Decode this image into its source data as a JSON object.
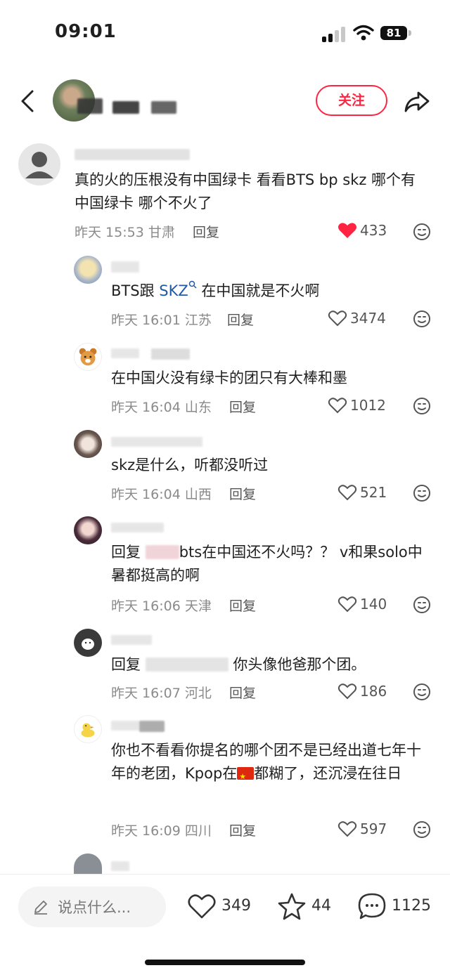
{
  "status": {
    "time": "09:01",
    "battery": "81"
  },
  "header": {
    "follow_label": "关注"
  },
  "comments": [
    {
      "text": "真的火的压根没有中国绿卡 看看BTS bp skz 哪个有中国绿卡 哪个不火了",
      "time": "昨天 15:53",
      "location": "甘肃",
      "reply_label": "回复",
      "likes": "433",
      "liked": true
    },
    {
      "text_pre": "BTS跟 ",
      "keyword": "SKZ",
      "text_post": " 在中国就是不火啊",
      "time": "昨天 16:01",
      "location": "江苏",
      "reply_label": "回复",
      "likes": "3474"
    },
    {
      "text": "在中国火没有绿卡的团只有大棒和墨",
      "time": "昨天 16:04",
      "location": "山东",
      "reply_label": "回复",
      "likes": "1012"
    },
    {
      "text": "skz是什么，听都没听过",
      "time": "昨天 16:04",
      "location": "山西",
      "reply_label": "回复",
      "likes": "521"
    },
    {
      "text_pre": "回复",
      "text_post": "bts在中国还不火吗？？ v和果solo中暑都挺高的啊",
      "time": "昨天 16:06",
      "location": "天津",
      "reply_label": "回复",
      "likes": "140"
    },
    {
      "text_pre": "回复",
      "text_post": "你头像他爸那个团。",
      "time": "昨天 16:07",
      "location": "河北",
      "reply_label": "回复",
      "likes": "186"
    },
    {
      "text_pre": "你也不看看你提名的哪个团不是已经出道七年十年的老团，Kpop在",
      "text_post": "都糊了，还沉浸在往日",
      "time": "昨天 16:09",
      "location": "四川",
      "reply_label": "回复",
      "likes": "597"
    }
  ],
  "bottom_bar": {
    "input_placeholder": "说点什么...",
    "likes": "349",
    "stars": "44",
    "comments": "1125"
  }
}
